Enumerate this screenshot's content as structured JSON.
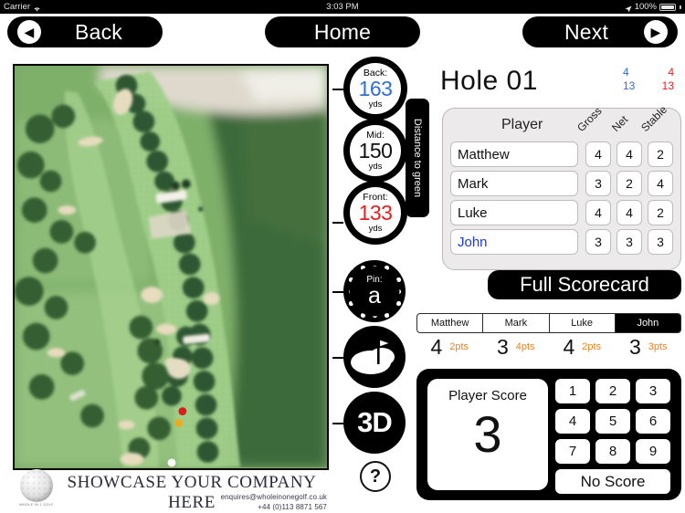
{
  "status_bar": {
    "carrier": "Carrier",
    "wifi_icon": "wifi-icon",
    "time": "3:03 PM",
    "location_icon": "location-arrow-icon",
    "battery_percent": "100%",
    "battery_icon": "battery-full-icon"
  },
  "nav": {
    "back_label": "Back",
    "home_label": "Home",
    "next_label": "Next",
    "back_icon": "chevron-left-circle-icon",
    "next_icon": "chevron-right-circle-icon"
  },
  "map": {
    "name": "hole-aerial-map",
    "markers": [
      "red-distance-marker",
      "yellow-distance-marker",
      "white-distance-marker"
    ]
  },
  "banner": {
    "title": "SHOWCASE YOUR COMPANY HERE",
    "email": "enquires@wholeinonegolf.co.uk",
    "phone": "+44 (0)113 8871 567",
    "logo_caption": "WHOLE IN 1 GOLF"
  },
  "distances": {
    "tab_label": "Distance to green",
    "back": {
      "label": "Back:",
      "value": "163",
      "unit": "yds",
      "color": "#2f6ed5"
    },
    "mid": {
      "label": "Mid:",
      "value": "150",
      "unit": "yds",
      "color": "#111111"
    },
    "front": {
      "label": "Front:",
      "value": "133",
      "unit": "yds",
      "color": "#e81d1d"
    }
  },
  "side_buttons": {
    "pin_label": "Pin:",
    "pin_value": "a",
    "green_icon": "green-flag-icon",
    "three_d_label": "3D",
    "help_label": "?"
  },
  "hole": {
    "title": "Hole 01",
    "blue_par": "4",
    "red_par": "4",
    "blue_si": "13",
    "red_si": "13"
  },
  "scorecard": {
    "player_header": "Player",
    "col_headers": [
      "Gross",
      "Net",
      "Stable"
    ],
    "rows": [
      {
        "name": "Matthew",
        "gross": "4",
        "net": "4",
        "stable": "2",
        "active": false
      },
      {
        "name": "Mark",
        "gross": "3",
        "net": "2",
        "stable": "4",
        "active": false
      },
      {
        "name": "Luke",
        "gross": "4",
        "net": "4",
        "stable": "2",
        "active": false
      },
      {
        "name": "John",
        "gross": "3",
        "net": "3",
        "stable": "3",
        "active": true
      }
    ],
    "full_scorecard_label": "Full Scorecard"
  },
  "player_tabs": {
    "items": [
      "Matthew",
      "Mark",
      "Luke",
      "John"
    ],
    "selected": "John"
  },
  "score_strip": [
    {
      "score": "4",
      "points": "2pts"
    },
    {
      "score": "3",
      "points": "4pts"
    },
    {
      "score": "4",
      "points": "2pts"
    },
    {
      "score": "3",
      "points": "3pts"
    }
  ],
  "scoring_pad": {
    "display_label": "Player Score",
    "display_value": "3",
    "keys": [
      "1",
      "2",
      "3",
      "4",
      "5",
      "6",
      "7",
      "8",
      "9"
    ],
    "no_score_label": "No Score"
  },
  "colors": {
    "accent_blue": "#2f6ed5",
    "accent_red": "#e81d1d",
    "points_orange": "#e8821e",
    "panel_gray": "#eceaea"
  }
}
